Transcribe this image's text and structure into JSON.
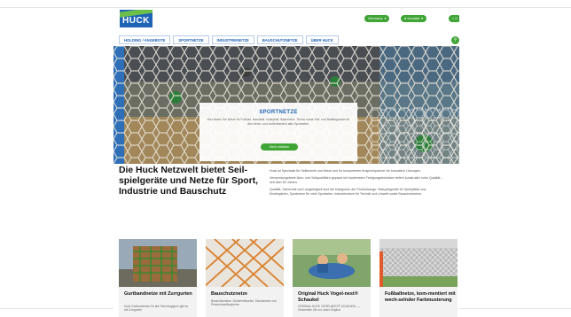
{
  "header": {
    "logo_text": "HUCK",
    "lang_label": "Germany",
    "contact_label": "Kontakt",
    "cart_label": "0"
  },
  "nav": {
    "items": [
      {
        "label": "HOLDING / ANGEBOTE"
      },
      {
        "label": "SPORTNETZE"
      },
      {
        "label": "INDUSTRIENETZE"
      },
      {
        "label": "BAUSCHUTZNETZE"
      },
      {
        "label": "ÜBER HUCK"
      }
    ]
  },
  "hero": {
    "title": "SPORTNETZE",
    "text": "Hier finden Sie Netze für Fußball, Handball, Volleyball, Badminton, Tennis sowie Seil- und Ballfangnetze für den Innen- und Außenbereich aller Sportarten.",
    "button_label": "Mehr erfahren"
  },
  "intro": {
    "title": "Die Huck Netzwelt bietet Seil-spielgeräte und Netze für Sport, Industrie und Bauschutz",
    "paragraphs": [
      "Huck ist Spezialist für Seiltechnik und Netze und Ihr kompetenter Ansprechpartner für innovative Lösungen.",
      "Verwendungsfeste Netz- und Seilqualitäten gepaart mit modernsten Fertigungstechniken liefern konstruktiv hohe Qualität – seit über 50 Jahren.",
      "Qualität, Sicherheit und Langlebigkeit sind die Kategorien der Produktrange: Seilspielgeräte für Spielplätze und Kindergärten, Sportnetze für viele Sportarten, Industrienetze für Technik und Umwelt sowie Bauschutznetze."
    ]
  },
  "cards": [
    {
      "title": "Gurtbandnetze mit Zurrgurten",
      "subtitle": "Huck Gurtbandnetze für alle Fahrzeugtypen gibt es mit Zurrgurten"
    },
    {
      "title": "Bauschutznetze",
      "subtitle": "Bauschutznetze, Sicherheitsnetze, Schutznetze und Personenauffangnetze"
    },
    {
      "title": "Original Huck Vogel-nest® Schaukel",
      "subtitle": "ORIGINAL HUCK VOGELNEST® SCHAUKEL — Verwenden Sie nur unser Original"
    },
    {
      "title": "Fußballnetze, kom-mentiert mit wech-selnder Farbmusterung",
      "subtitle": ""
    }
  ],
  "colors": {
    "brand_blue": "#1e63b5",
    "brand_green": "#3fa535"
  }
}
